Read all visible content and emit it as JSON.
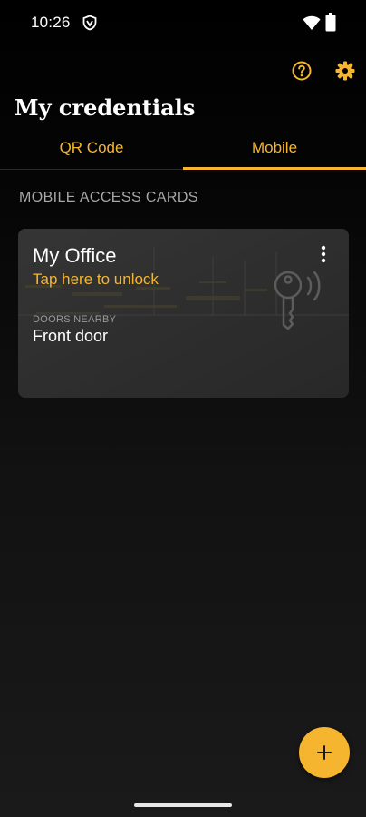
{
  "status_bar": {
    "time": "10:26",
    "icons": [
      "vpn-shield-icon",
      "wifi-icon",
      "battery-icon"
    ]
  },
  "app_bar": {
    "title": "My credentials",
    "actions": [
      {
        "name": "help-icon",
        "label": "Help"
      },
      {
        "name": "settings-icon",
        "label": "Settings"
      }
    ]
  },
  "tabs": [
    {
      "label": "QR Code",
      "selected": false
    },
    {
      "label": "Mobile",
      "selected": true
    }
  ],
  "section": {
    "label": "MOBILE ACCESS CARDS"
  },
  "card": {
    "title": "My Office",
    "subtitle": "Tap here to unlock",
    "doors_label": "DOORS NEARBY",
    "doors_value": "Front door",
    "menu_icon": "more-vertical-icon",
    "badge_icon": "key-wireless-icon"
  },
  "fab": {
    "icon": "plus-icon"
  },
  "colors": {
    "accent": "#f5b52e",
    "background": "#000000",
    "card": "#2c2c2c",
    "muted_text": "#a8a8a8"
  }
}
